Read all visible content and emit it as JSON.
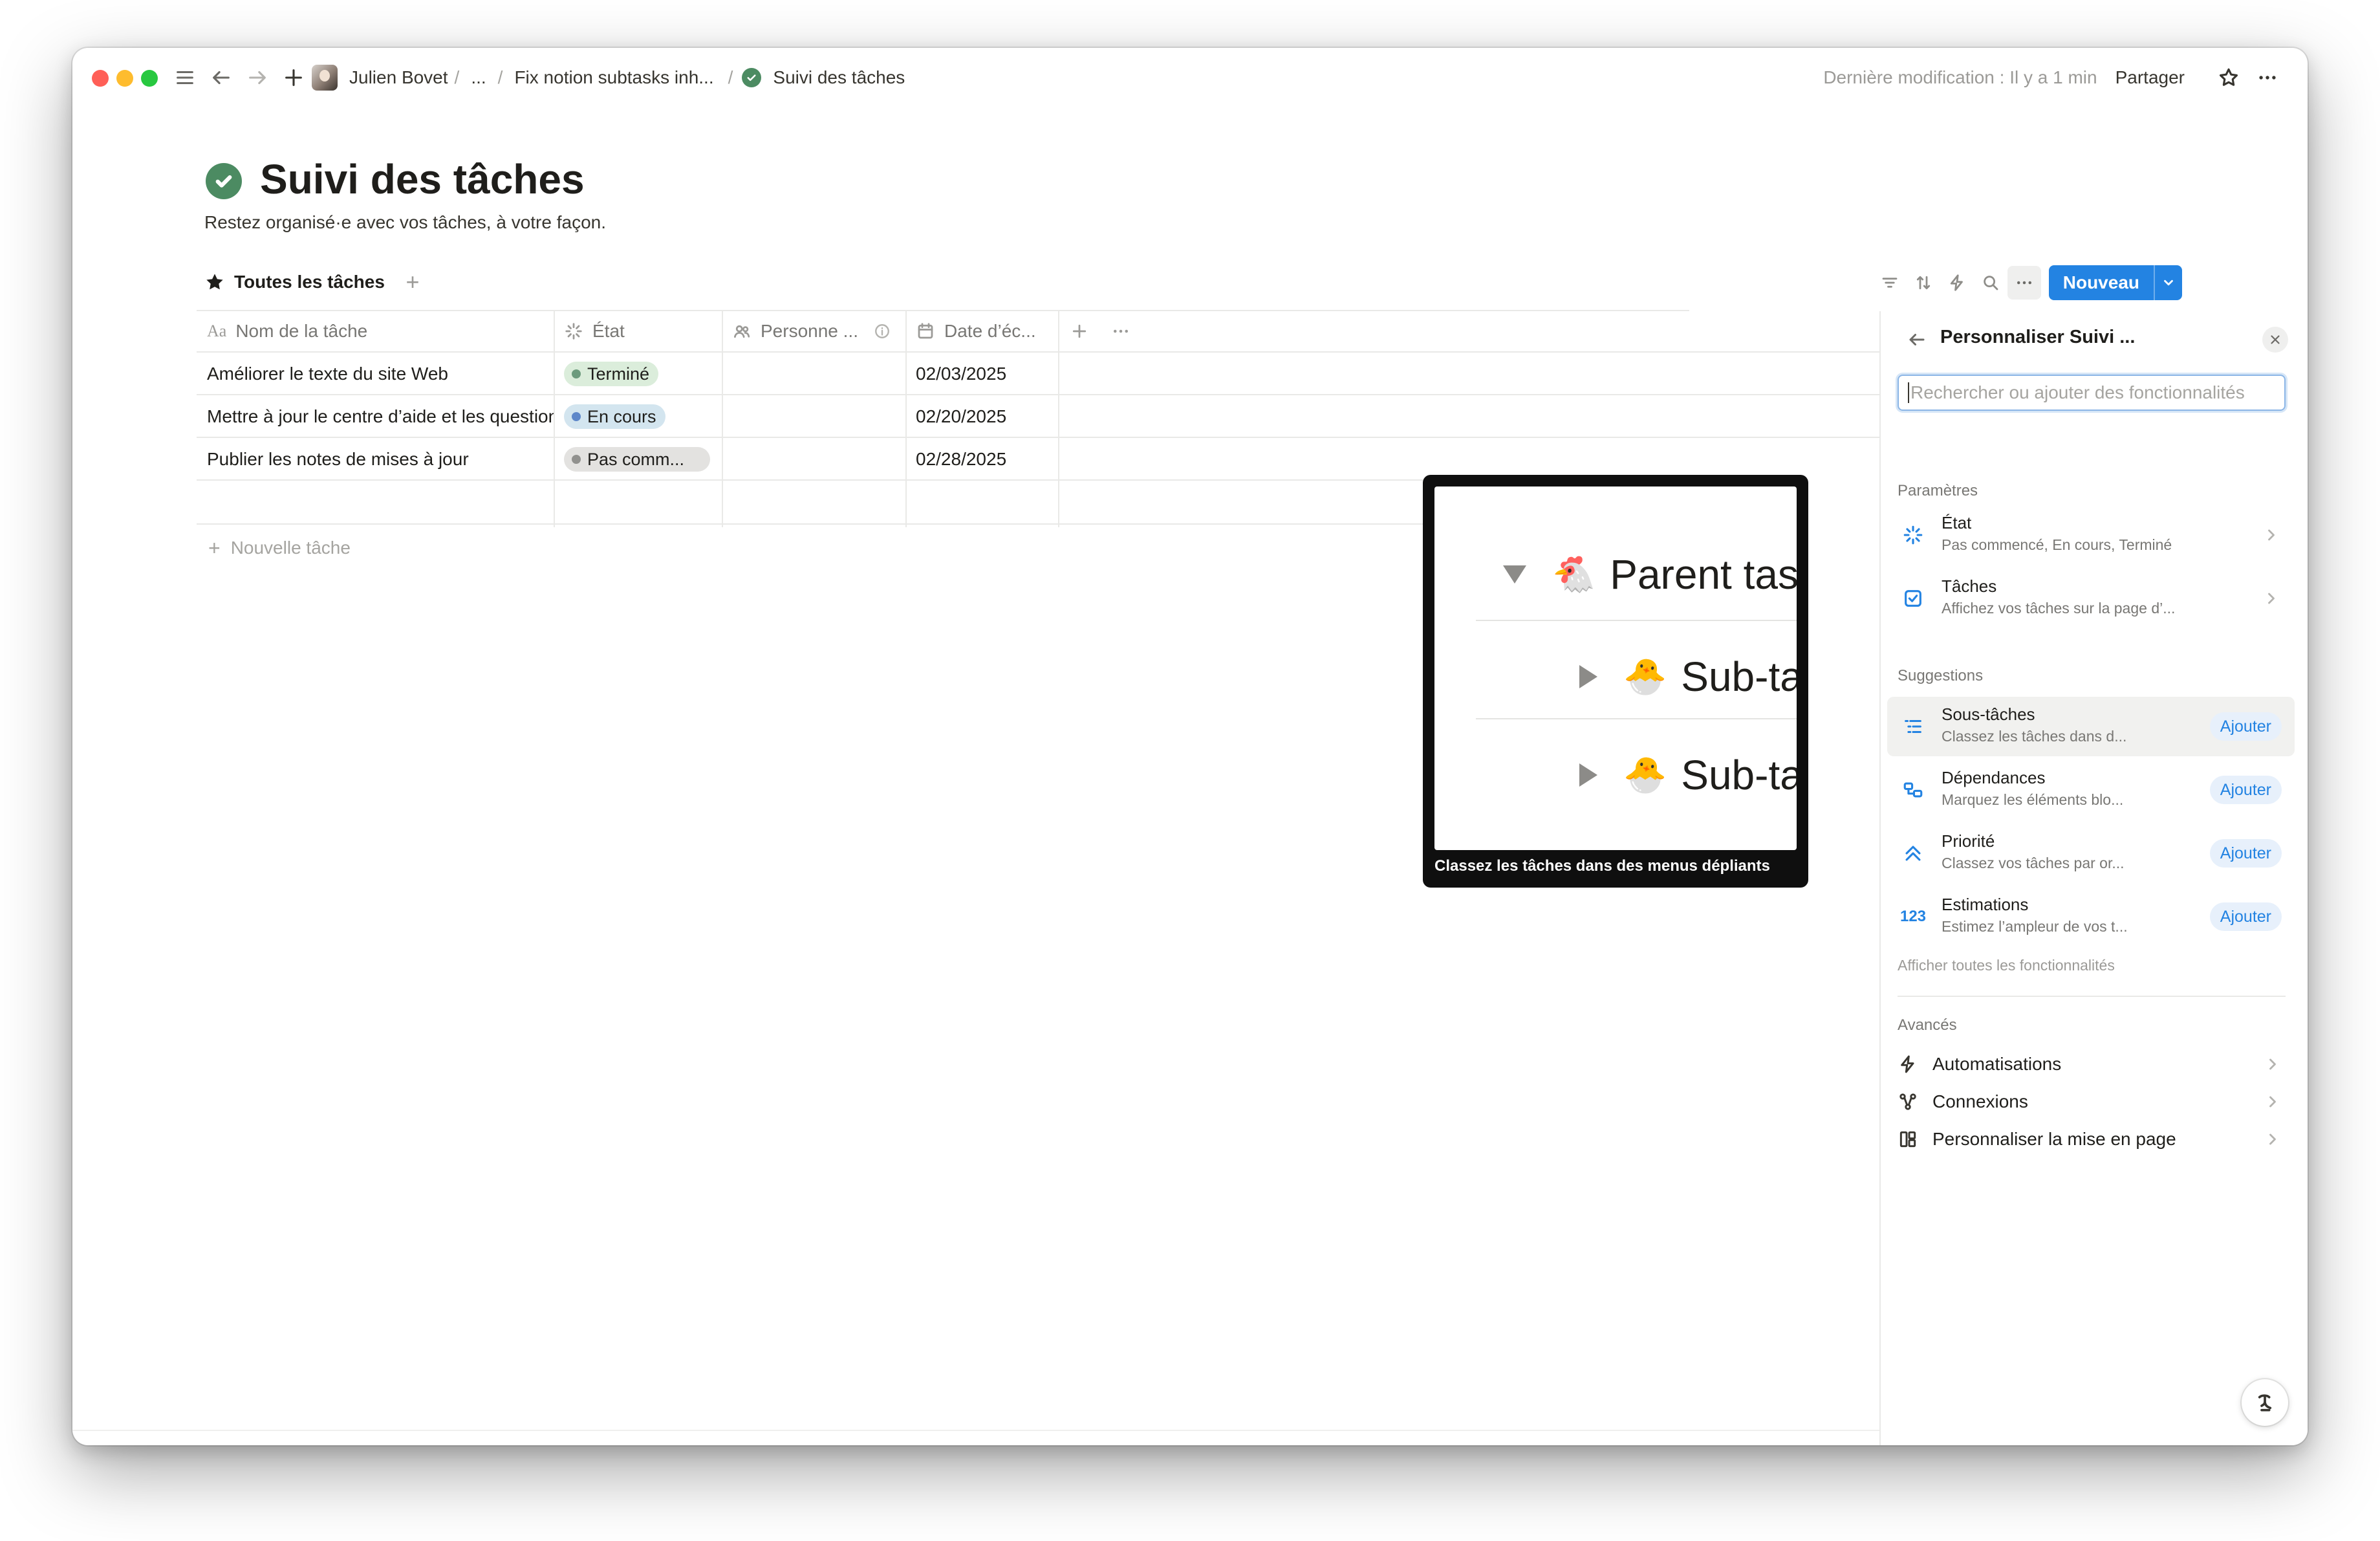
{
  "breadcrumb": {
    "user": "Julien Bovet",
    "sep1": "/",
    "ellipsis": "...",
    "sep2": "/",
    "parent": "Fix notion subtasks inh...",
    "sep3": "/",
    "current": "Suivi des tâches"
  },
  "topbar": {
    "last_modified": "Dernière modification : Il y a 1 min",
    "share": "Partager"
  },
  "page": {
    "title": "Suivi des tâches",
    "description": "Restez organisé·e avec vos tâches, à votre façon."
  },
  "view": {
    "tab_label": "Toutes les tâches",
    "add": "+"
  },
  "toolbar": {
    "new_label": "Nouveau"
  },
  "table": {
    "columns": [
      {
        "prefix": "Aa",
        "label": "Nom de la tâche"
      },
      {
        "label": "État"
      },
      {
        "label": "Personne ..."
      },
      {
        "label": "Date d’éc..."
      }
    ],
    "rows": [
      {
        "name": "Améliorer le texte du site Web",
        "status": "Terminé",
        "person": "",
        "date": "02/03/2025"
      },
      {
        "name": "Mettre à jour le centre d’aide et les questions fréquentes",
        "status": "En cours",
        "person": "",
        "date": "02/20/2025"
      },
      {
        "name": "Publier les notes de mises à jour",
        "status": "Pas comm...",
        "person": "",
        "date": "02/28/2025"
      }
    ],
    "new_row": "Nouvelle tâche"
  },
  "preview": {
    "parent_text": "Parent task",
    "sub1_text": "Sub-task",
    "sub2_text": "Sub-task",
    "caption": "Classez les tâches dans des menus dépliants"
  },
  "panel": {
    "title": "Personnaliser Suivi ...",
    "search_placeholder": "Rechercher ou ajouter des fonctionnalités",
    "section_params": "Paramètres",
    "params": [
      {
        "title": "État",
        "subtitle": "Pas commencé, En cours, Terminé"
      },
      {
        "title": "Tâches",
        "subtitle": "Affichez vos tâches sur la page d’..."
      }
    ],
    "section_suggestions": "Suggestions",
    "suggestions": [
      {
        "title": "Sous-tâches",
        "subtitle": "Classez les tâches dans d...",
        "action": "Ajouter"
      },
      {
        "title": "Dépendances",
        "subtitle": "Marquez les éléments blo...",
        "action": "Ajouter"
      },
      {
        "title": "Priorité",
        "subtitle": "Classez vos tâches par or...",
        "action": "Ajouter"
      },
      {
        "title": "Estimations",
        "subtitle": "Estimez l’ampleur de vos t...",
        "action": "Ajouter",
        "icon_text": "123"
      }
    ],
    "show_all": "Afficher toutes les fonctionnalités",
    "section_advanced": "Avancés",
    "advanced": [
      {
        "label": "Automatisations"
      },
      {
        "label": "Connexions"
      },
      {
        "label": "Personnaliser la mise en page"
      }
    ]
  },
  "colors": {
    "accent": "#2383e2",
    "status_done": "#dbeddb",
    "status_in_progress": "#d3e5ef",
    "status_not_started": "#e3e2e0",
    "page_icon": "#4c8b62"
  }
}
